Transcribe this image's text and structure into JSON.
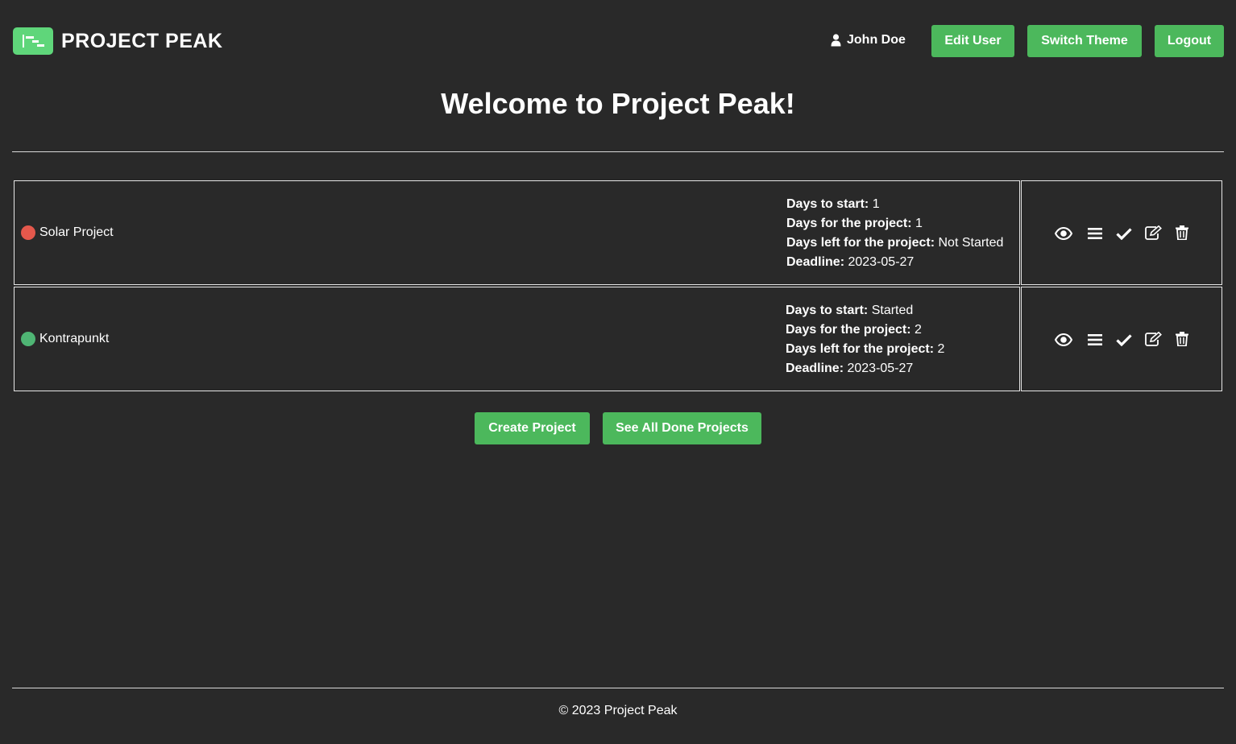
{
  "brand": {
    "name": "PROJECT PEAK",
    "color": "#5fd67a"
  },
  "header": {
    "user_name": "John Doe",
    "user_icon": "user-icon",
    "edit_user_label": "Edit User",
    "switch_theme_label": "Switch Theme",
    "logout_label": "Logout"
  },
  "main": {
    "title": "Welcome to Project Peak!",
    "projects": [
      {
        "name": "Solar Project",
        "status_color": "#e4584c",
        "days_to_start_label": "Days to start:",
        "days_to_start": "1",
        "days_for_project_label": "Days for the project:",
        "days_for_project": "1",
        "days_left_label": "Days left for the project:",
        "days_left": "Not Started",
        "deadline_label": "Deadline:",
        "deadline": "2023-05-27"
      },
      {
        "name": "Kontrapunkt",
        "status_color": "#4fb574",
        "days_to_start_label": "Days to start:",
        "days_to_start": "Started",
        "days_for_project_label": "Days for the project:",
        "days_for_project": "2",
        "days_left_label": "Days left for the project:",
        "days_left": "2",
        "deadline_label": "Deadline:",
        "deadline": "2023-05-27"
      }
    ],
    "action_icons": [
      "eye-icon",
      "list-icon",
      "check-icon",
      "edit-icon",
      "trash-icon"
    ],
    "create_project_label": "Create Project",
    "see_done_label": "See All Done Projects"
  },
  "footer": {
    "text": "© 2023 Project Peak"
  },
  "colors": {
    "background": "#292929",
    "button": "#4cb85c",
    "text": "#ffffff"
  }
}
